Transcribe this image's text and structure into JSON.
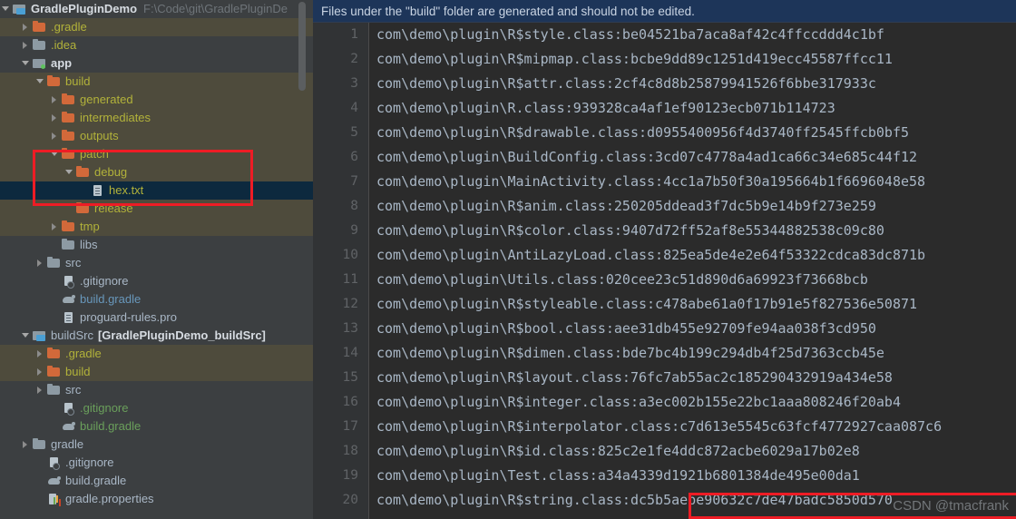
{
  "project_tree": {
    "root": {
      "label": "GradlePluginDemo",
      "path": "F:\\Code\\git\\GradlePluginDe"
    },
    "items": [
      {
        "label": ".gradle",
        "indent": 1,
        "arrow": "right",
        "icon": "folder-orange-icon",
        "color": "olive",
        "tint": true,
        "selected": false
      },
      {
        "label": ".idea",
        "indent": 1,
        "arrow": "right",
        "icon": "folder-grey-icon",
        "color": "olive",
        "tint": false,
        "selected": false
      },
      {
        "label": "app",
        "indent": 1,
        "arrow": "down",
        "icon": "module-src-icon",
        "color": "white",
        "tint": false,
        "selected": false,
        "bold": true
      },
      {
        "label": "build",
        "indent": 2,
        "arrow": "down",
        "icon": "folder-orange-icon",
        "color": "olive",
        "tint": true,
        "selected": false
      },
      {
        "label": "generated",
        "indent": 3,
        "arrow": "right",
        "icon": "folder-orange-icon",
        "color": "olive",
        "tint": true,
        "selected": false
      },
      {
        "label": "intermediates",
        "indent": 3,
        "arrow": "right",
        "icon": "folder-orange-icon",
        "color": "olive",
        "tint": true,
        "selected": false
      },
      {
        "label": "outputs",
        "indent": 3,
        "arrow": "right",
        "icon": "folder-orange-icon",
        "color": "olive",
        "tint": true,
        "selected": false
      },
      {
        "label": "patch",
        "indent": 3,
        "arrow": "down",
        "icon": "folder-orange-icon",
        "color": "olive",
        "tint": true,
        "selected": false
      },
      {
        "label": "debug",
        "indent": 4,
        "arrow": "down",
        "icon": "folder-orange-icon",
        "color": "olive",
        "tint": true,
        "selected": false
      },
      {
        "label": "hex.txt",
        "indent": 5,
        "arrow": "none",
        "icon": "text-file-icon",
        "color": "olive",
        "tint": false,
        "selected": true
      },
      {
        "label": "release",
        "indent": 4,
        "arrow": "none",
        "icon": "folder-orange-icon",
        "color": "olive",
        "tint": true,
        "selected": false
      },
      {
        "label": "tmp",
        "indent": 3,
        "arrow": "right",
        "icon": "folder-orange-icon",
        "color": "olive",
        "tint": true,
        "selected": false
      },
      {
        "label": "libs",
        "indent": 3,
        "arrow": "none",
        "icon": "folder-grey-icon",
        "color": "grey",
        "tint": false,
        "selected": false
      },
      {
        "label": "src",
        "indent": 2,
        "arrow": "right",
        "icon": "folder-grey-icon",
        "color": "grey",
        "tint": false,
        "selected": false
      },
      {
        "label": ".gitignore",
        "indent": 3,
        "arrow": "none",
        "icon": "gitignore-icon",
        "color": "grey",
        "tint": false,
        "selected": false
      },
      {
        "label": "build.gradle",
        "indent": 3,
        "arrow": "none",
        "icon": "gradle-icon",
        "color": "blue",
        "tint": false,
        "selected": false
      },
      {
        "label": "proguard-rules.pro",
        "indent": 3,
        "arrow": "none",
        "icon": "text-file-icon",
        "color": "grey",
        "tint": false,
        "selected": false
      },
      {
        "label": "buildSrc",
        "indent": 1,
        "arrow": "down",
        "icon": "module-icon",
        "color": "grey",
        "tint": false,
        "selected": false,
        "suffix": "[GradlePluginDemo_buildSrc]"
      },
      {
        "label": ".gradle",
        "indent": 2,
        "arrow": "right",
        "icon": "folder-orange-icon",
        "color": "olive",
        "tint": true,
        "selected": false
      },
      {
        "label": "build",
        "indent": 2,
        "arrow": "right",
        "icon": "folder-orange-icon",
        "color": "olive",
        "tint": true,
        "selected": false
      },
      {
        "label": "src",
        "indent": 2,
        "arrow": "right",
        "icon": "folder-grey-icon",
        "color": "grey",
        "tint": false,
        "selected": false
      },
      {
        "label": ".gitignore",
        "indent": 3,
        "arrow": "none",
        "icon": "gitignore-icon",
        "color": "green",
        "tint": false,
        "selected": false
      },
      {
        "label": "build.gradle",
        "indent": 3,
        "arrow": "none",
        "icon": "gradle-icon",
        "color": "green",
        "tint": false,
        "selected": false
      },
      {
        "label": "gradle",
        "indent": 1,
        "arrow": "right",
        "icon": "folder-grey-icon",
        "color": "grey",
        "tint": false,
        "selected": false
      },
      {
        "label": ".gitignore",
        "indent": 2,
        "arrow": "none",
        "icon": "gitignore-icon",
        "color": "grey",
        "tint": false,
        "selected": false
      },
      {
        "label": "build.gradle",
        "indent": 2,
        "arrow": "none",
        "icon": "gradle-icon",
        "color": "grey",
        "tint": false,
        "selected": false
      },
      {
        "label": "gradle.properties",
        "indent": 2,
        "arrow": "none",
        "icon": "properties-icon",
        "color": "grey",
        "tint": false,
        "selected": false
      }
    ]
  },
  "editor": {
    "notice": "Files under the \"build\" folder are generated and should not be edited.",
    "lines": [
      {
        "n": "1",
        "text": "com\\demo\\plugin\\R$style.class:be04521ba7aca8af42c4ffccddd4c1bf"
      },
      {
        "n": "2",
        "text": "com\\demo\\plugin\\R$mipmap.class:bcbe9dd89c1251d419ecc45587ffcc11"
      },
      {
        "n": "3",
        "text": "com\\demo\\plugin\\R$attr.class:2cf4c8d8b25879941526f6bbe317933c"
      },
      {
        "n": "4",
        "text": "com\\demo\\plugin\\R.class:939328ca4af1ef90123ecb071b114723"
      },
      {
        "n": "5",
        "text": "com\\demo\\plugin\\R$drawable.class:d0955400956f4d3740ff2545ffcb0bf5"
      },
      {
        "n": "6",
        "text": "com\\demo\\plugin\\BuildConfig.class:3cd07c4778a4ad1ca66c34e685c44f12"
      },
      {
        "n": "7",
        "text": "com\\demo\\plugin\\MainActivity.class:4cc1a7b50f30a195664b1f6696048e58"
      },
      {
        "n": "8",
        "text": "com\\demo\\plugin\\R$anim.class:250205ddead3f7dc5b9e14b9f273e259"
      },
      {
        "n": "9",
        "text": "com\\demo\\plugin\\R$color.class:9407d72ff52af8e55344882538c09c80"
      },
      {
        "n": "10",
        "text": "com\\demo\\plugin\\AntiLazyLoad.class:825ea5de4e2e64f53322cdca83dc871b"
      },
      {
        "n": "11",
        "text": "com\\demo\\plugin\\Utils.class:020cee23c51d890d6a69923f73668bcb"
      },
      {
        "n": "12",
        "text": "com\\demo\\plugin\\R$styleable.class:c478abe61a0f17b91e5f827536e50871"
      },
      {
        "n": "13",
        "text": "com\\demo\\plugin\\R$bool.class:aee31db455e92709fe94aa038f3cd950"
      },
      {
        "n": "14",
        "text": "com\\demo\\plugin\\R$dimen.class:bde7bc4b199c294db4f25d7363ccb45e"
      },
      {
        "n": "15",
        "text": "com\\demo\\plugin\\R$layout.class:76fc7ab55ac2c185290432919a434e58"
      },
      {
        "n": "16",
        "text": "com\\demo\\plugin\\R$integer.class:a3ec002b155e22bc1aaa808246f20ab4"
      },
      {
        "n": "17",
        "text": "com\\demo\\plugin\\R$interpolator.class:c7d613e5545c63fcf4772927caa087c6"
      },
      {
        "n": "18",
        "text": "com\\demo\\plugin\\R$id.class:825c2e1fe4ddc872acbe6029a17b02e8"
      },
      {
        "n": "19",
        "text": "com\\demo\\plugin\\Test.class:a34a4339d1921b6801384de495e00da1",
        "highlighted": true
      },
      {
        "n": "20",
        "text": "com\\demo\\plugin\\R$string.class:dc5b5aebe90632c7de47badc5850d570"
      }
    ],
    "watermark": "CSDN @tmacfrank"
  },
  "colors": {
    "annotation_red": "#ee1c25",
    "selection_blue": "#0d293e",
    "notice_blue": "#1d3559",
    "tree_bg": "#3c3f41",
    "editor_bg": "#2b2b2b",
    "gutter_bg": "#313335",
    "folder_orange": "#d2693a",
    "label_olive": "#b2b23a"
  }
}
